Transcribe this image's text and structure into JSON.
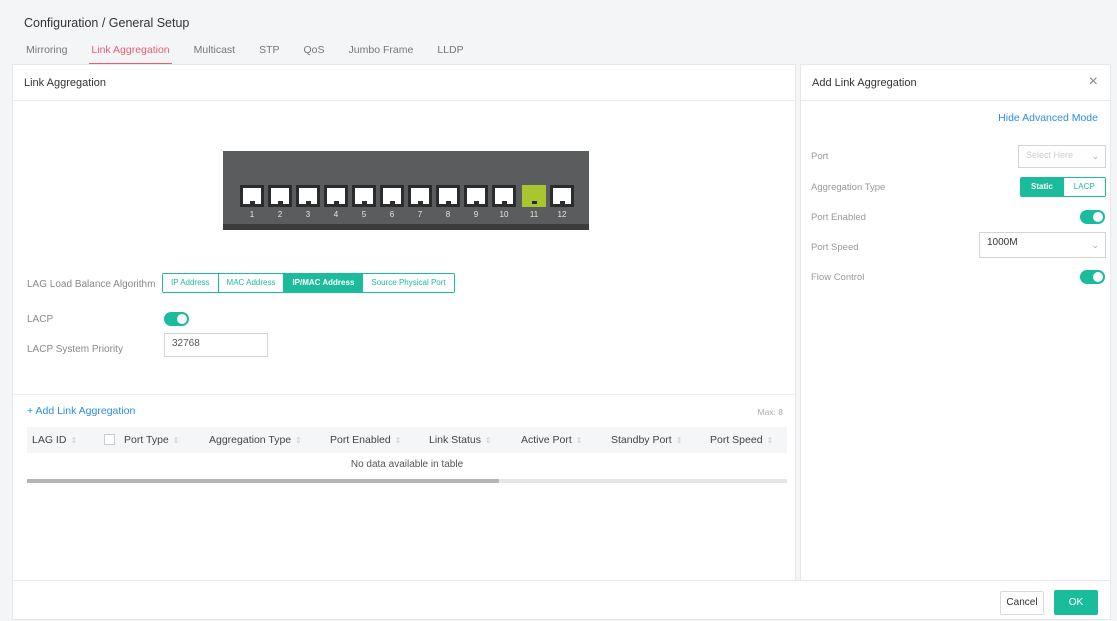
{
  "breadcrumb": "Configuration / General Setup",
  "tabs": [
    "Mirroring",
    "Link Aggregation",
    "Multicast",
    "STP",
    "QoS",
    "Jumbo Frame",
    "LLDP"
  ],
  "left_panel": {
    "title": "Link Aggregation",
    "ports": [
      "1",
      "2",
      "3",
      "4",
      "5",
      "6",
      "7",
      "8",
      "9",
      "10",
      "11",
      "12"
    ],
    "selected_port": "11",
    "lag_algo_label": "LAG Load Balance Algorithm",
    "lag_algo_options": [
      "IP Address",
      "MAC Address",
      "IP/MAC Address",
      "Source Physical Port"
    ],
    "lag_algo_selected": "IP/MAC Address",
    "lacp_label": "LACP",
    "lacp_priority_label": "LACP System Priority",
    "lacp_priority_value": "32768",
    "add_link": "+ Add Link Aggregation",
    "max": "Max: 8",
    "table_headers": [
      "LAG ID",
      "Port Type",
      "Aggregation Type",
      "Port Enabled",
      "Link Status",
      "Active Port",
      "Standby Port",
      "Port Speed"
    ],
    "empty_text": "No data available in table"
  },
  "right_panel": {
    "title": "Add Link Aggregation",
    "close": "×",
    "hide_advanced": "Hide Advanced Mode",
    "port_label": "Port",
    "port_placeholder": "Select Here",
    "agg_type_label": "Aggregation Type",
    "agg_type_options": [
      "Static",
      "LACP"
    ],
    "port_enabled_label": "Port Enabled",
    "port_speed_label": "Port Speed",
    "port_speed_value": "1000M",
    "flow_control_label": "Flow Control"
  },
  "footer": {
    "cancel": "Cancel",
    "ok": "OK"
  },
  "colors": {
    "accent": "#1bbc9b",
    "tab_active": "#e76072",
    "link": "#2d8ce6",
    "selected_port": "#a9c630"
  }
}
